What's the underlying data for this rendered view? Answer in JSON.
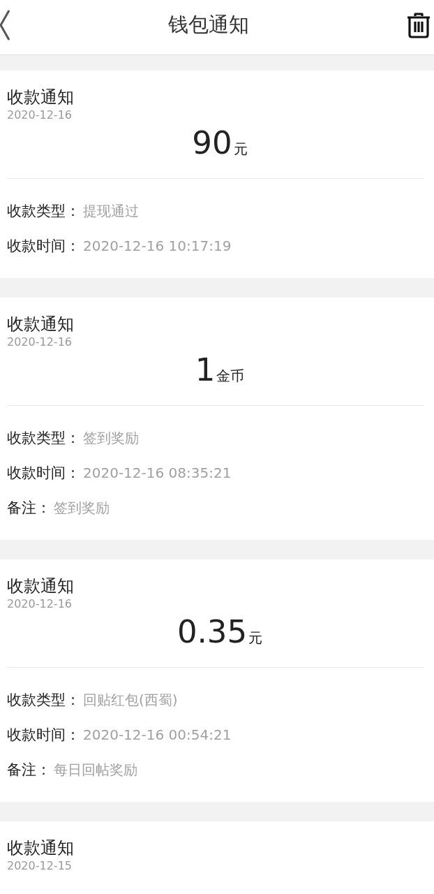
{
  "header": {
    "title": "钱包通知"
  },
  "notices": [
    {
      "title": "收款通知",
      "date": "2020-12-16",
      "amount": "90",
      "unit": "元",
      "rows": [
        {
          "label": "收款类型：",
          "value": "提现通过"
        },
        {
          "label": "收款时间：",
          "value": "2020-12-16 10:17:19"
        }
      ]
    },
    {
      "title": "收款通知",
      "date": "2020-12-16",
      "amount": "1",
      "unit": "金币",
      "rows": [
        {
          "label": "收款类型：",
          "value": "签到奖励"
        },
        {
          "label": "收款时间：",
          "value": "2020-12-16 08:35:21"
        },
        {
          "label": "备注：",
          "value": "签到奖励"
        }
      ]
    },
    {
      "title": "收款通知",
      "date": "2020-12-16",
      "amount": "0.35",
      "unit": "元",
      "rows": [
        {
          "label": "收款类型：",
          "value": "回贴红包(西蜀)"
        },
        {
          "label": "收款时间：",
          "value": "2020-12-16 00:54:21"
        },
        {
          "label": "备注：",
          "value": "每日回帖奖励"
        }
      ]
    },
    {
      "title": "收款通知",
      "date": "2020-12-15"
    }
  ]
}
